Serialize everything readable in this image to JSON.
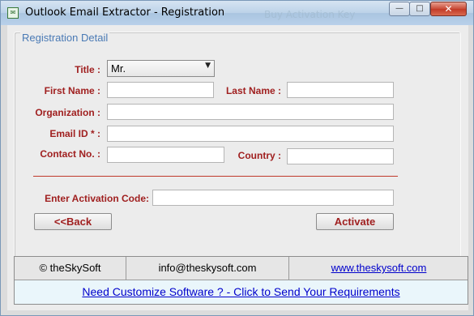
{
  "window": {
    "title": "Outlook Email Extractor - Registration",
    "background_title": "Buy Activation Key",
    "controls": {
      "minimize": "—",
      "maximize": "□",
      "close": "✕"
    },
    "app_icon": "outlook-extractor-icon"
  },
  "form": {
    "group_title": "Registration Detail",
    "title_label": "Title :",
    "title_value": "Mr.",
    "first_name_label": "First Name :",
    "first_name_value": "",
    "last_name_label": "Last Name :",
    "last_name_value": "",
    "organization_label": "Organization :",
    "organization_value": "",
    "email_label": "Email ID * :",
    "email_value": "",
    "contact_label": "Contact No. :",
    "contact_value": "",
    "country_label": "Country :",
    "country_value": "",
    "activation_label": "Enter Activation Code:",
    "activation_value": "",
    "back_button": "<<Back",
    "activate_button": "Activate"
  },
  "footer": {
    "copyright": "© theSkySoft",
    "email": "info@theskysoft.com",
    "website": "www.theskysoft.com",
    "banner": "Need Customize Software ? - Click to Send Your Requirements"
  },
  "colors": {
    "label": "#a02020",
    "group_title": "#4a7ab5",
    "divider": "#c0392b",
    "link": "#0000cc"
  }
}
